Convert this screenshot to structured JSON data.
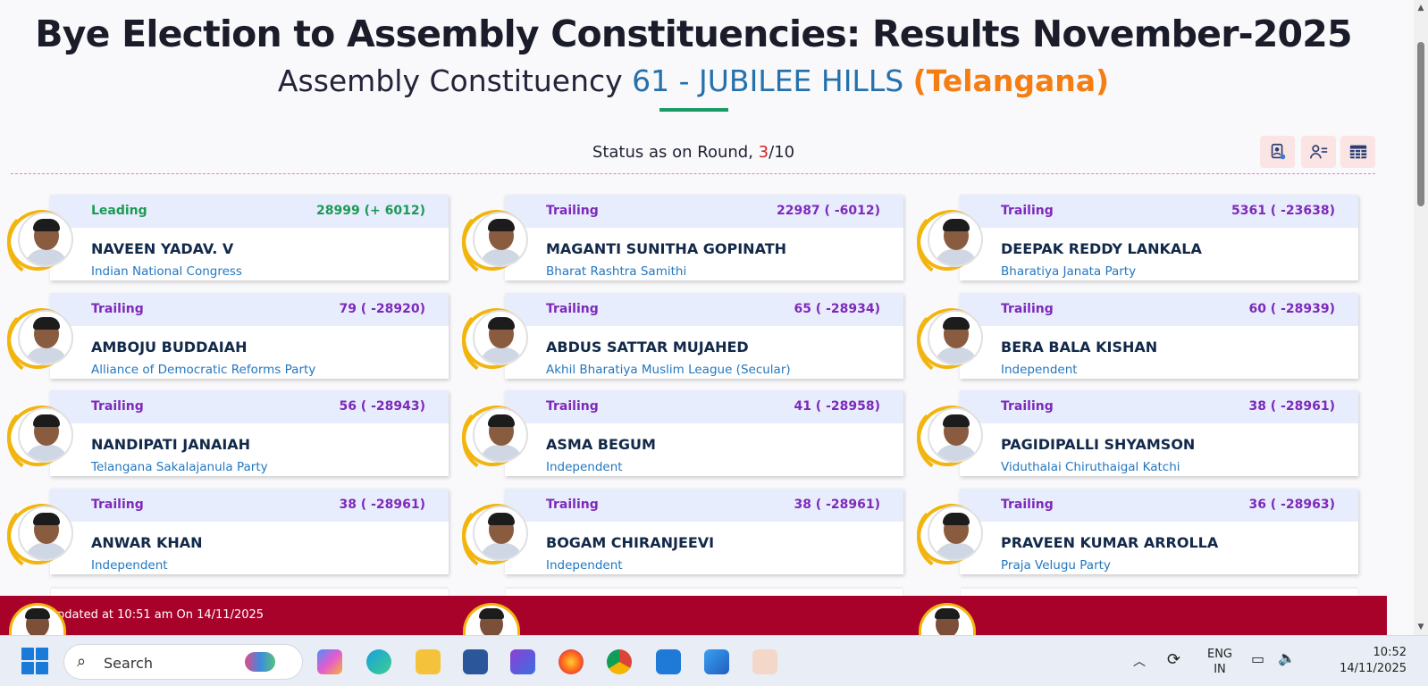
{
  "header": {
    "title": "Bye Election to Assembly Constituencies: Results November-2025",
    "subtitle_prefix": "Assembly Constituency",
    "constituency": "61 - JUBILEE HILLS",
    "state": "(Telangana)"
  },
  "status": {
    "label": "Status as on Round,",
    "current_round": "3",
    "total_rounds": "/10"
  },
  "toolbar": {
    "icons": [
      "chart-person-icon",
      "person-list-icon",
      "table-icon"
    ]
  },
  "candidates": [
    {
      "status": "Leading",
      "votes": "28999 (+ 6012)",
      "name": "NAVEEN YADAV. V",
      "party": "Indian National Congress"
    },
    {
      "status": "Trailing",
      "votes": "22987 ( -6012)",
      "name": "MAGANTI SUNITHA GOPINATH",
      "party": "Bharat Rashtra Samithi"
    },
    {
      "status": "Trailing",
      "votes": "5361 ( -23638)",
      "name": "DEEPAK REDDY LANKALA",
      "party": "Bharatiya Janata Party"
    },
    {
      "status": "Trailing",
      "votes": "79 ( -28920)",
      "name": "AMBOJU BUDDAIAH",
      "party": "Alliance of Democratic Reforms Party"
    },
    {
      "status": "Trailing",
      "votes": "65 ( -28934)",
      "name": "ABDUS SATTAR MUJAHED",
      "party": "Akhil Bharatiya Muslim League (Secular)"
    },
    {
      "status": "Trailing",
      "votes": "60 ( -28939)",
      "name": "BERA BALA KISHAN",
      "party": "Independent"
    },
    {
      "status": "Trailing",
      "votes": "56 ( -28943)",
      "name": "NANDIPATI JANAIAH",
      "party": "Telangana Sakalajanula Party"
    },
    {
      "status": "Trailing",
      "votes": "41 ( -28958)",
      "name": "ASMA BEGUM",
      "party": "Independent"
    },
    {
      "status": "Trailing",
      "votes": "38 ( -28961)",
      "name": "PAGIDIPALLI SHYAMSON",
      "party": "Viduthalai Chiruthaigal Katchi"
    },
    {
      "status": "Trailing",
      "votes": "38 ( -28961)",
      "name": "ANWAR KHAN",
      "party": "Independent"
    },
    {
      "status": "Trailing",
      "votes": "38 ( -28961)",
      "name": "BOGAM CHIRANJEEVI",
      "party": "Independent"
    },
    {
      "status": "Trailing",
      "votes": "36 ( -28963)",
      "name": "PRAVEEN KUMAR ARROLLA",
      "party": "Praja Velugu Party"
    }
  ],
  "footer": {
    "updated": "pdated at 10:51 am On 14/11/2025"
  },
  "colors": {
    "leading": "#1c9a55",
    "trailing": "#7d2ab9",
    "accent_orange": "#f57e13",
    "accent_blue": "#2571ac",
    "footer_bg": "#a8022b"
  },
  "taskbar": {
    "search_label": "Search",
    "language_line1": "ENG",
    "language_line2": "IN",
    "time": "10:52",
    "date": "14/11/2025"
  }
}
